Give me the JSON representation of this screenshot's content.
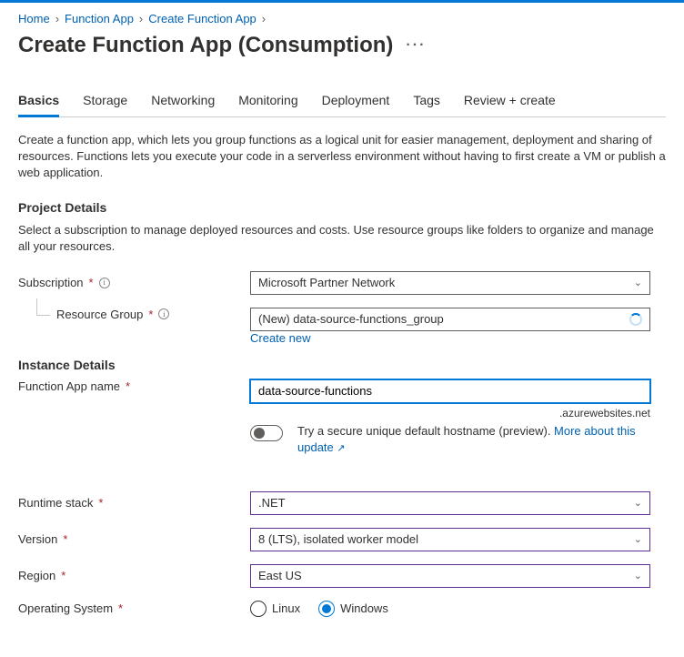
{
  "breadcrumb": {
    "home": "Home",
    "l1": "Function App",
    "l2": "Create Function App"
  },
  "title": "Create Function App (Consumption)",
  "tabs": [
    "Basics",
    "Storage",
    "Networking",
    "Monitoring",
    "Deployment",
    "Tags",
    "Review + create"
  ],
  "intro": "Create a function app, which lets you group functions as a logical unit for easier management, deployment and sharing of resources. Functions lets you execute your code in a serverless environment without having to first create a VM or publish a web application.",
  "projectDetails": {
    "heading": "Project Details",
    "helper": "Select a subscription to manage deployed resources and costs. Use resource groups like folders to organize and manage all your resources.",
    "subLabel": "Subscription",
    "subValue": "Microsoft Partner Network",
    "rgLabel": "Resource Group",
    "rgValue": "(New) data-source-functions_group",
    "createNew": "Create new"
  },
  "instanceDetails": {
    "heading": "Instance Details",
    "nameLabel": "Function App name",
    "nameValue": "data-source-functions",
    "suffix": ".azurewebsites.net",
    "toggleText": "Try a secure unique default hostname (preview). ",
    "toggleLink": "More about this update",
    "runtimeLabel": "Runtime stack",
    "runtimeValue": ".NET",
    "versionLabel": "Version",
    "versionValue": "8 (LTS), isolated worker model",
    "regionLabel": "Region",
    "regionValue": "East US",
    "osLabel": "Operating System",
    "osLinux": "Linux",
    "osWindows": "Windows"
  }
}
